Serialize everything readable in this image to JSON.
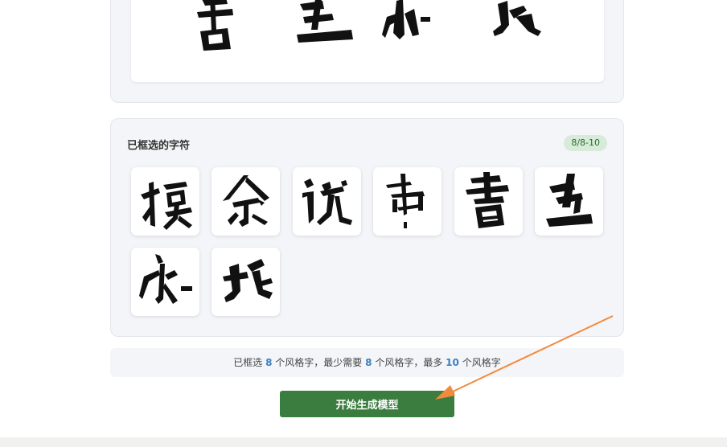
{
  "selection": {
    "title": "已框选的字符",
    "badge": "8/8-10"
  },
  "info": {
    "prefix": "已框选",
    "selected_count": "8",
    "mid1": "个风格字，最少需要",
    "min_count": "8",
    "mid2": "个风格字，最多",
    "max_count": "10",
    "suffix": "个风格字"
  },
  "generate_button": {
    "label": "开始生成模型"
  },
  "colors": {
    "accent_green": "#3a7d3f",
    "badge_bg": "#d6ecd8",
    "number_blue": "#3a7fc1",
    "arrow_orange": "#f28a3c"
  }
}
